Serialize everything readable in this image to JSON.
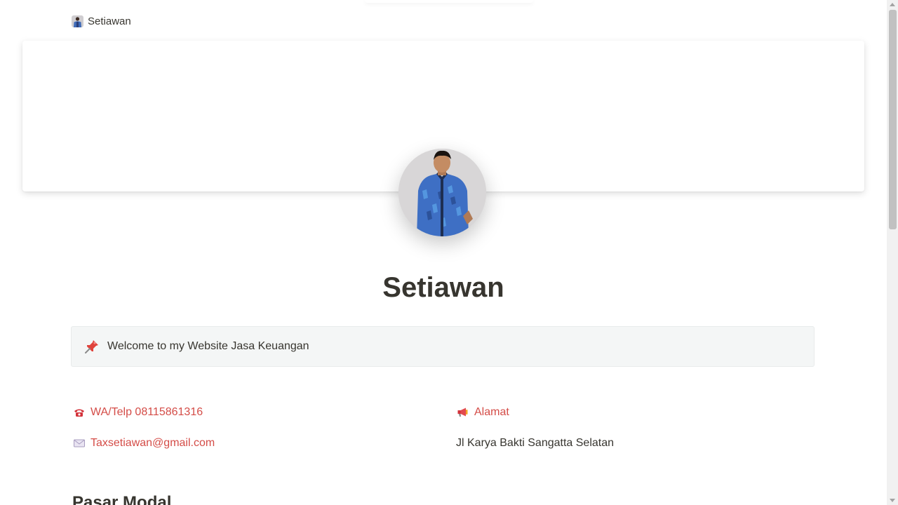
{
  "breadcrumb": {
    "label": "Setiawan",
    "icon": "profile-photo-icon"
  },
  "page": {
    "title": "Setiawan",
    "avatar_icon": "profile-photo"
  },
  "callout": {
    "icon": "pushpin-icon",
    "text": "Welcome to my Website Jasa Keuangan",
    "background": "#f4f6f6"
  },
  "contacts": {
    "phone": {
      "icon": "telephone-icon",
      "label": "WA/Telp 08115861316"
    },
    "email": {
      "icon": "envelope-icon",
      "label": "Taxsetiawan@gmail.com"
    },
    "address_heading": {
      "icon": "megaphone-icon",
      "label": "Alamat"
    },
    "address_value": "Jl Karya Bakti Sangatta Selatan"
  },
  "section": {
    "heading": "Pasar Modal"
  },
  "colors": {
    "link": "#d44c47",
    "text": "#37352f",
    "background": "#ffffff"
  }
}
